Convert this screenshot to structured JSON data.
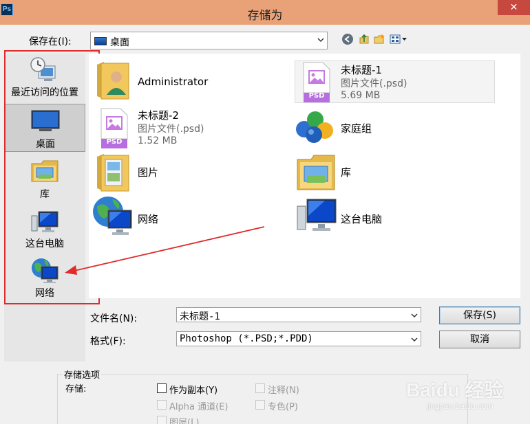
{
  "window": {
    "app_icon_label": "Ps",
    "title": "存储为",
    "close_label": "✕"
  },
  "save_in": {
    "label": "保存在(I):",
    "value": "桌面"
  },
  "toolbar": {
    "icons": [
      "back-icon",
      "up-folder-icon",
      "new-folder-icon",
      "view-menu-icon"
    ]
  },
  "places": [
    {
      "label": "最近访问的位置",
      "icon": "recent-places-icon"
    },
    {
      "label": "桌面",
      "icon": "desktop-icon"
    },
    {
      "label": "库",
      "icon": "libraries-icon"
    },
    {
      "label": "这台电脑",
      "icon": "this-pc-icon"
    },
    {
      "label": "网络",
      "icon": "network-icon"
    }
  ],
  "files": [
    {
      "name": "Administrator",
      "icon": "user-folder-icon"
    },
    {
      "name": "未标题-1",
      "type": "图片文件(.psd)",
      "size": "5.69 MB",
      "badge": "PSD",
      "icon": "psd-file-icon"
    },
    {
      "name": "未标题-2",
      "type": "图片文件(.psd)",
      "size": "1.52 MB",
      "badge": "PSD",
      "icon": "psd-file-icon"
    },
    {
      "name": "家庭组",
      "icon": "homegroup-icon"
    },
    {
      "name": "图片",
      "icon": "pictures-folder-icon"
    },
    {
      "name": "库",
      "icon": "libraries-icon"
    },
    {
      "name": "网络",
      "icon": "network-icon"
    },
    {
      "name": "这台电脑",
      "icon": "this-pc-icon"
    }
  ],
  "filename": {
    "label": "文件名(N):",
    "value": "未标题-1"
  },
  "format": {
    "label": "格式(F):",
    "value": "Photoshop (*.PSD;*.PDD)"
  },
  "buttons": {
    "save": "保存(S)",
    "cancel": "取消"
  },
  "save_options": {
    "title": "存储选项",
    "save_label": "存储:",
    "as_copy": "作为副本(Y)",
    "notes": "注释(N)",
    "alpha": "Alpha 通道(E)",
    "spot": "专色(P)",
    "layers": "图层(L)"
  },
  "watermark": {
    "text": "Baidu 经验",
    "url": "jingyan.baidu.com"
  },
  "colors": {
    "titlebar": "#e9a277",
    "close": "#c7483f",
    "annotation_red": "#e02b2b"
  }
}
